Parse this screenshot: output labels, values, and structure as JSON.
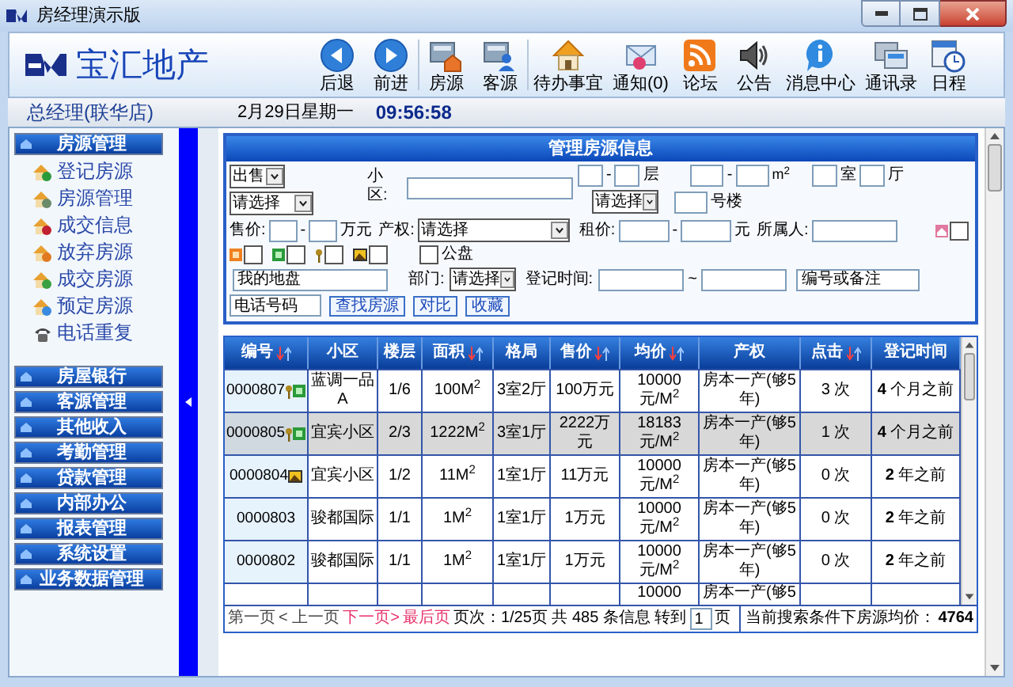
{
  "window": {
    "title": "房经理演示版"
  },
  "brand": "宝汇地产",
  "toolbar": [
    [
      {
        "kind": "back",
        "label": "后退"
      },
      {
        "kind": "forward",
        "label": "前进"
      }
    ],
    [
      {
        "kind": "listing",
        "label": "房源"
      },
      {
        "kind": "client",
        "label": "客源"
      }
    ],
    [
      {
        "kind": "todo",
        "label": "待办事宜"
      },
      {
        "kind": "mail",
        "label": "通知(0)"
      },
      {
        "kind": "rss",
        "label": "论坛"
      },
      {
        "kind": "speaker",
        "label": "公告"
      },
      {
        "kind": "info",
        "label": "消息中心"
      },
      {
        "kind": "windows",
        "label": "通讯录"
      },
      {
        "kind": "calendar",
        "label": "日程"
      }
    ]
  ],
  "status": {
    "user": "总经理(联华店)",
    "date": "2月29日星期一",
    "time": "09:56:58"
  },
  "sidebar": {
    "groups": [
      {
        "label": "房源管理",
        "children": [
          {
            "kind": "add",
            "label": "登记房源"
          },
          {
            "kind": "manage",
            "label": "房源管理"
          },
          {
            "kind": "deal",
            "label": "成交信息"
          },
          {
            "kind": "abandon",
            "label": "放弃房源"
          },
          {
            "kind": "done",
            "label": "成交房源"
          },
          {
            "kind": "reserve",
            "label": "预定房源"
          },
          {
            "kind": "phone",
            "label": "电话重复"
          }
        ]
      },
      {
        "label": "房屋银行"
      },
      {
        "label": "客源管理"
      },
      {
        "label": "其他收入"
      },
      {
        "label": "考勤管理"
      },
      {
        "label": "贷款管理"
      },
      {
        "label": "内部办公"
      },
      {
        "label": "报表管理"
      },
      {
        "label": "系统设置"
      },
      {
        "label": "业务数据管理"
      }
    ]
  },
  "panel": {
    "title": "管理房源信息"
  },
  "search": {
    "trade_type": "出售",
    "type_select": "请选择",
    "community_label": "小区:",
    "range_separator": "-",
    "floor_unit": "层",
    "area_unit": "m$^{2}$",
    "rooms_unit": "室",
    "halls_unit": "厅",
    "building_select": "请选择",
    "building_unit": "号楼",
    "price_label": "售价:",
    "price_unit": "万元",
    "title_label": "产权:",
    "title_select": "请选择",
    "rent_label": "租价:",
    "rent_unit": "元",
    "owner_label": "所属人:",
    "flags": [
      {
        "kind": "pink",
        "checked": false
      },
      {
        "kind": "orange",
        "checked": false
      },
      {
        "kind": "green",
        "checked": false
      },
      {
        "kind": "key",
        "checked": false
      },
      {
        "kind": "photo",
        "checked": false
      }
    ],
    "public_label": "公盘",
    "public_checked": false,
    "my_area_placeholder": "我的地盘",
    "dept_label": "部门:",
    "dept_select": "请选择",
    "date_label": "登记时间:",
    "date_separator": "~",
    "code_placeholder": "编号或备注",
    "phone_placeholder": "电话号码",
    "buttons": [
      "查找房源",
      "对比",
      "收藏"
    ]
  },
  "table": {
    "columns": [
      {
        "label": "编号",
        "sortable": true
      },
      {
        "label": "小区",
        "sortable": false
      },
      {
        "label": "楼层",
        "sortable": false
      },
      {
        "label": "面积",
        "sortable": true
      },
      {
        "label": "格局",
        "sortable": false
      },
      {
        "label": "售价",
        "sortable": true
      },
      {
        "label": "均价",
        "sortable": true
      },
      {
        "label": "产权",
        "sortable": false
      },
      {
        "label": "点击",
        "sortable": true
      },
      {
        "label": "登记时间",
        "sortable": false
      }
    ],
    "rows": [
      {
        "selected": false,
        "id_icons": [
          {
            "kind": "key"
          },
          {
            "kind": "green"
          }
        ],
        "cells": [
          "0000807",
          "蓝调一品A",
          "1/6",
          "100M$^{2}$",
          "3室2厅",
          "100万元",
          "10000元/M$^{2}$",
          "房本一产(够5年)",
          "3 次",
          "**4** 个月之前"
        ]
      },
      {
        "selected": true,
        "id_icons": [
          {
            "kind": "key"
          },
          {
            "kind": "green"
          }
        ],
        "cells": [
          "0000805",
          "宜宾小区",
          "2/3",
          "1222M$^{2}$",
          "3室1厅",
          "2222万元",
          "18183元/M$^{2}$",
          "房本一产(够5年)",
          "1 次",
          "**4** 个月之前"
        ]
      },
      {
        "selected": false,
        "id_icons": [
          {
            "kind": "photo"
          }
        ],
        "cells": [
          "0000804",
          "宜宾小区",
          "1/2",
          "11M$^{2}$",
          "1室1厅",
          "11万元",
          "10000元/M$^{2}$",
          "房本一产(够5年)",
          "0 次",
          "**2** 年之前"
        ]
      },
      {
        "selected": false,
        "id_icons": [],
        "cells": [
          "0000803",
          "骏都国际",
          "1/1",
          "1M$^{2}$",
          "1室1厅",
          "1万元",
          "10000元/M$^{2}$",
          "房本一产(够5年)",
          "0 次",
          "**2** 年之前"
        ]
      },
      {
        "selected": false,
        "id_icons": [],
        "cells": [
          "0000802",
          "骏都国际",
          "1/1",
          "1M$^{2}$",
          "1室1厅",
          "1万元",
          "10000元/M$^{2}$",
          "房本一产(够5年)",
          "0 次",
          "**2** 年之前"
        ]
      }
    ],
    "partial_row": {
      "avg_price": "10000",
      "title": "房本一产(够5"
    }
  },
  "pager": {
    "links": [
      {
        "label": "第一页",
        "disabled": true
      },
      {
        "label": "< 上一页",
        "disabled": true
      },
      {
        "label": "下一页>",
        "disabled": false
      },
      {
        "label": "最后页",
        "disabled": false
      }
    ],
    "info": "页次：1/25页 共 485 条信息 转到",
    "page": "1",
    "page_unit": "页"
  },
  "average": {
    "label": "当前搜索条件下房源均价：",
    "value": "4764"
  }
}
